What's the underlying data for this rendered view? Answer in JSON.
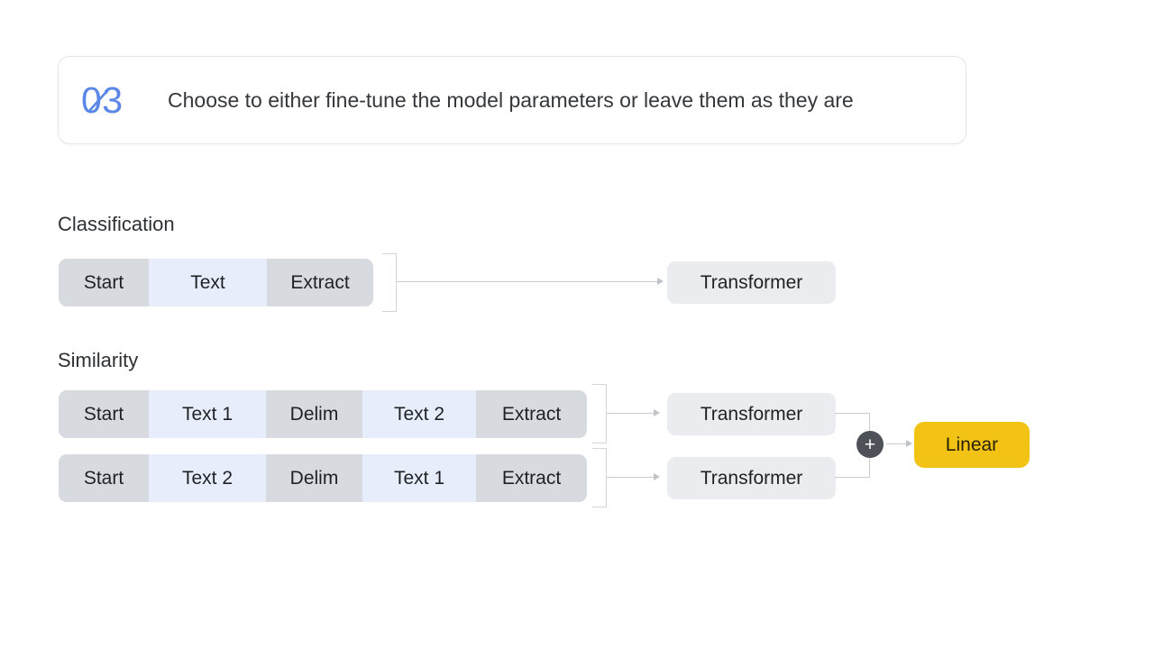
{
  "header": {
    "step_number": "03",
    "title": "Choose to either fine-tune the model parameters or leave them as they are",
    "accent_color": "#5b87e8"
  },
  "diagram": {
    "sections": [
      {
        "label": "Classification",
        "rows": [
          {
            "tokens": [
              {
                "label": "Start",
                "kind": "gray"
              },
              {
                "label": "Text",
                "kind": "blue"
              },
              {
                "label": "Extract",
                "kind": "gray"
              }
            ],
            "transformer": "Transformer"
          }
        ]
      },
      {
        "label": "Similarity",
        "rows": [
          {
            "tokens": [
              {
                "label": "Start",
                "kind": "gray"
              },
              {
                "label": "Text 1",
                "kind": "blue"
              },
              {
                "label": "Delim",
                "kind": "gray"
              },
              {
                "label": "Text 2",
                "kind": "blue"
              },
              {
                "label": "Extract",
                "kind": "gray"
              }
            ],
            "transformer": "Transformer"
          },
          {
            "tokens": [
              {
                "label": "Start",
                "kind": "gray"
              },
              {
                "label": "Text 2",
                "kind": "blue"
              },
              {
                "label": "Delim",
                "kind": "gray"
              },
              {
                "label": "Text 1",
                "kind": "blue"
              },
              {
                "label": "Extract",
                "kind": "gray"
              }
            ],
            "transformer": "Transformer"
          }
        ]
      }
    ],
    "merge_node": {
      "symbol": "+",
      "color": "#4e5158"
    },
    "output": {
      "label": "Linear",
      "color": "#f2c314"
    },
    "token_colors": {
      "gray": "#d7dade",
      "blue": "#e7edfb"
    },
    "transformer_color": "#eaecf0",
    "connector_color": "#c9ccd1"
  }
}
